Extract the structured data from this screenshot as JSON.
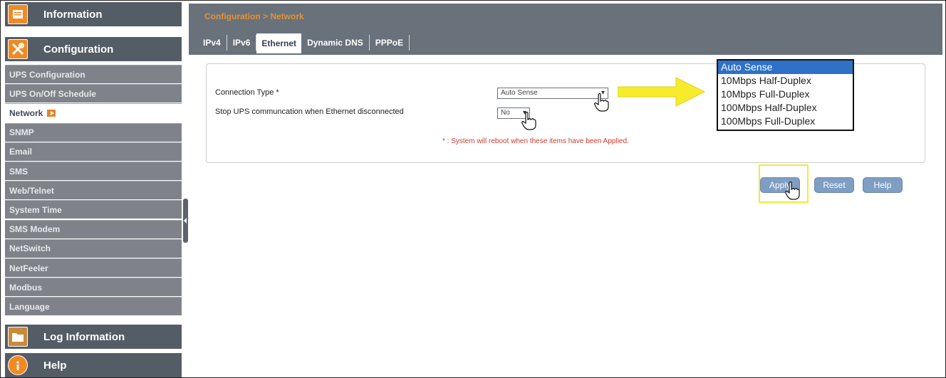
{
  "sidebar": {
    "sections": {
      "information": "Information",
      "configuration": "Configuration",
      "log_information": "Log Information",
      "help": "Help"
    },
    "items": [
      {
        "label": "UPS Configuration",
        "active": false
      },
      {
        "label": "UPS On/Off Schedule",
        "active": false
      },
      {
        "label": "Network",
        "active": true
      },
      {
        "label": "SNMP",
        "active": false
      },
      {
        "label": "Email",
        "active": false
      },
      {
        "label": "SMS",
        "active": false
      },
      {
        "label": "Web/Telnet",
        "active": false
      },
      {
        "label": "System Time",
        "active": false
      },
      {
        "label": "SMS Modem",
        "active": false
      },
      {
        "label": "NetSwitch",
        "active": false
      },
      {
        "label": "NetFeeler",
        "active": false
      },
      {
        "label": "Modbus",
        "active": false
      },
      {
        "label": "Language",
        "active": false
      }
    ]
  },
  "header": {
    "breadcrumb": "Configuration > Network",
    "tabs": [
      "IPv4",
      "IPv6",
      "Ethernet",
      "Dynamic DNS",
      "PPPoE"
    ],
    "active_tab": "Ethernet"
  },
  "form": {
    "connection_type_label": "Connection Type *",
    "connection_type_value": "Auto Sense",
    "stop_ups_label": "Stop UPS communcation when Ethernet disconnected",
    "stop_ups_value": "No",
    "reboot_note": "* : System will reboot when these items have been Applied."
  },
  "dropdown": {
    "options": [
      "Auto Sense",
      "10Mbps Half-Duplex",
      "10Mbps Full-Duplex",
      "100Mbps Half-Duplex",
      "100Mbps Full-Duplex"
    ],
    "selected": "Auto Sense"
  },
  "buttons": {
    "apply": "Apply",
    "reset": "Reset",
    "help": "Help"
  },
  "colors": {
    "header_bg": "#69717b",
    "breadcrumb": "#e59232",
    "sidebar_section": "#545c66",
    "sidebar_item": "#7f8389",
    "button": "#7f9ec3",
    "highlight": "#f2e93a",
    "dropdown_selected": "#2f71c7",
    "note": "#cc3a2c"
  }
}
